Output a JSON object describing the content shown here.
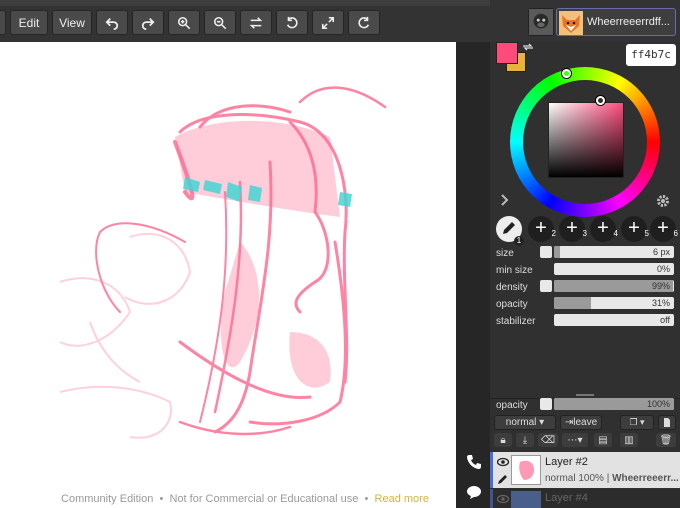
{
  "toolbar": {
    "edit_label": "Edit",
    "view_label": "View",
    "username": "Wheerreeerrdff..."
  },
  "color": {
    "primary": "#ff4b7c",
    "secondary": "#e8b33c",
    "hex_value": "ff4b7c"
  },
  "tools": {
    "slots": [
      "1",
      "2",
      "3",
      "4",
      "5",
      "6"
    ]
  },
  "brush": {
    "size_label": "size",
    "size_value": "6 px",
    "size_level": 0.05,
    "min_size_label": "min size",
    "min_size_value": "0%",
    "min_size_level": 0,
    "density_label": "density",
    "density_value": "99%",
    "density_level": 0.99,
    "opacity_label": "opacity",
    "opacity_value": "31%",
    "opacity_level": 0.31,
    "stabilizer_label": "stabilizer",
    "stabilizer_value": "off"
  },
  "layer_panel": {
    "opacity_label": "opacity",
    "opacity_value": "100%",
    "opacity_level": 1.0,
    "blend_mode": "normal",
    "leave_label": "leave"
  },
  "layers": [
    {
      "name": "Layer #2",
      "info_mode": "normal 100%",
      "info_owner": "Wheerreeerr..."
    },
    {
      "name": "Layer #4"
    }
  ],
  "footer": {
    "edition": "Community Edition",
    "sep1": "•",
    "notice": "Not for Commercial or Educational use",
    "sep2": "•",
    "read_more": "Read more"
  }
}
